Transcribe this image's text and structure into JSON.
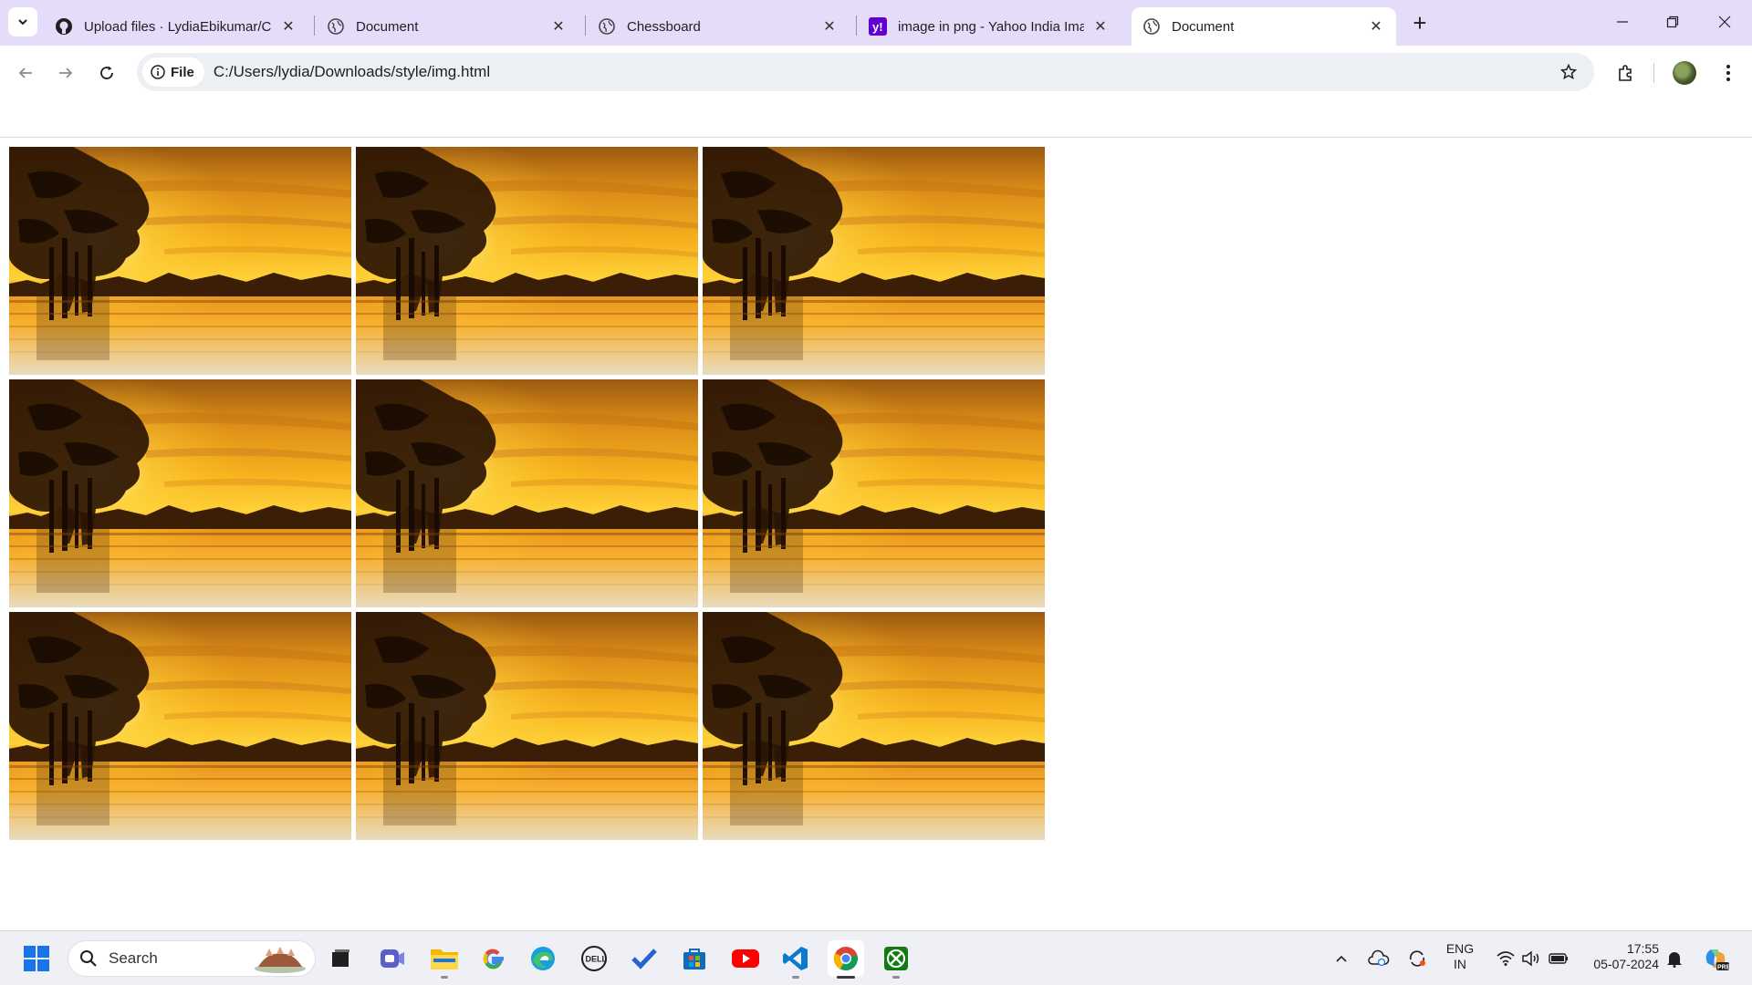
{
  "browser": {
    "tabs": [
      {
        "title": "Upload files · LydiaEbikumar/Ch",
        "icon": "github-icon",
        "active": false
      },
      {
        "title": "Document",
        "icon": "globe-icon",
        "active": false
      },
      {
        "title": "Chessboard",
        "icon": "globe-icon",
        "active": false
      },
      {
        "title": "image in png - Yahoo India Ima",
        "icon": "yahoo-icon",
        "active": false
      },
      {
        "title": "Document",
        "icon": "globe-icon",
        "active": true
      }
    ],
    "address": {
      "chip_label": "File",
      "url": "C:/Users/lydia/Downloads/style/img.html"
    }
  },
  "page": {
    "image_count": 9,
    "image_subject": "sunset-trees-lake"
  },
  "taskbar": {
    "search_placeholder": "Search",
    "apps": [
      "start-icon",
      "search-icon",
      "task-view-icon",
      "teams-icon",
      "file-explorer-icon",
      "google-icon",
      "edge-icon",
      "dell-icon",
      "todo-icon",
      "store-icon",
      "youtube-icon",
      "vscode-icon",
      "chrome-icon",
      "xbox-icon"
    ],
    "tray": {
      "language_top": "ENG",
      "language_bottom": "IN",
      "time": "17:55",
      "date": "05-07-2024"
    }
  },
  "colors": {
    "tabstrip_bg": "#e5dcfa",
    "omnibox_bg": "#eceff3",
    "taskbar_bg": "#eef0f5"
  }
}
